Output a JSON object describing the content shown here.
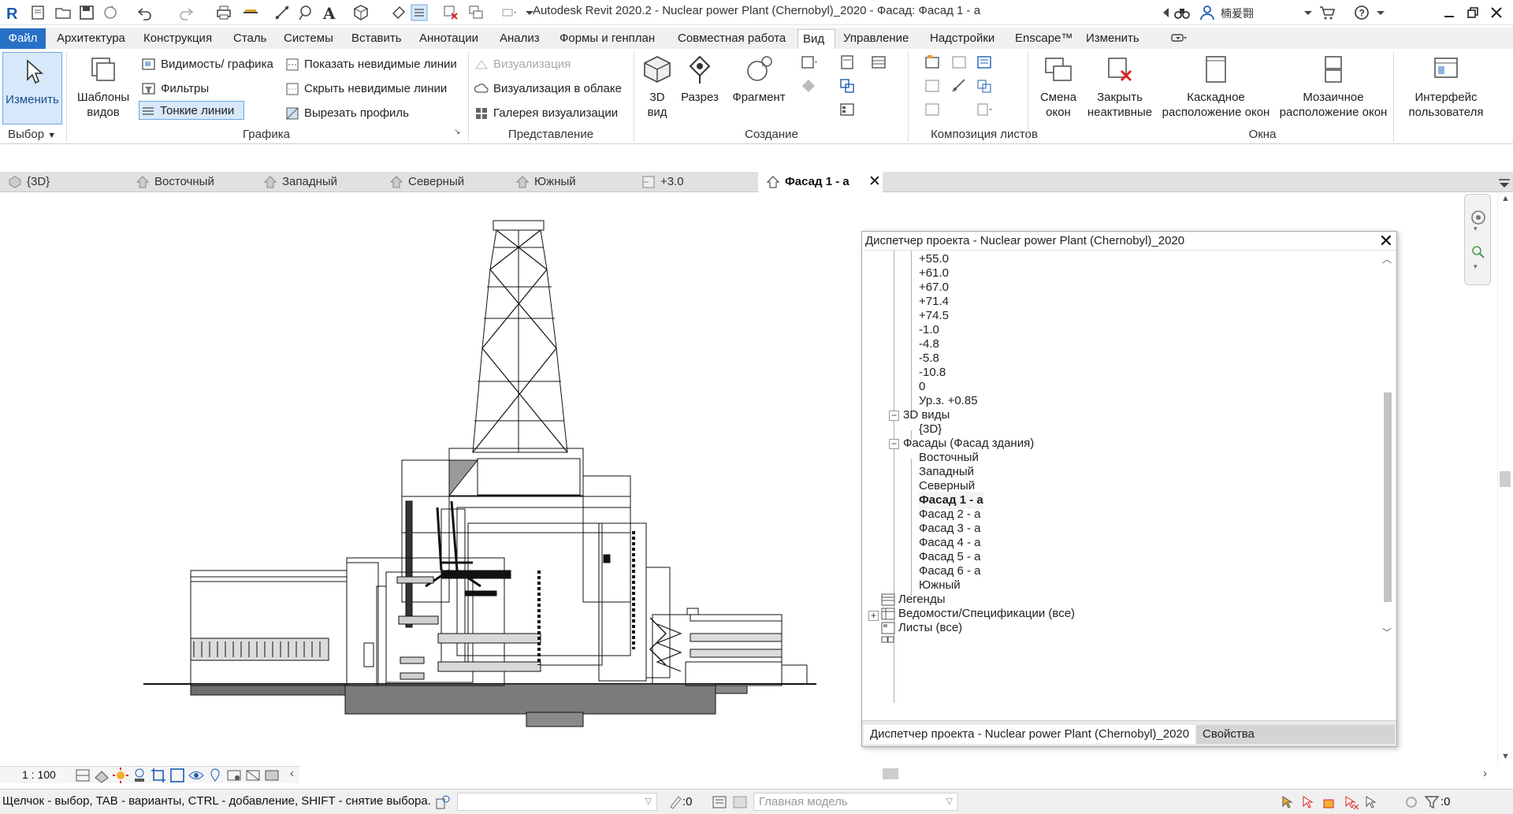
{
  "app_title": "Autodesk Revit 2020.2 - Nuclear power Plant (Chernobyl)_2020 - Фасад: Фасад 1 - а",
  "user_name": "楠爰翾",
  "menu": {
    "file": "Файл",
    "tabs": [
      "Архитектура",
      "Конструкция",
      "Сталь",
      "Системы",
      "Вставить",
      "Аннотации",
      "Анализ",
      "Формы и генплан",
      "Совместная работа",
      "Вид",
      "Управление",
      "Надстройки",
      "Enscape™",
      "Изменить"
    ],
    "active_tab": "Вид"
  },
  "ribbon": {
    "modify_label": "Изменить",
    "templates_label_1": "Шаблоны",
    "templates_label_2": "видов",
    "visibility_graphics": "Видимость/ графика",
    "filters": "Фильтры",
    "thin_lines": "Тонкие линии",
    "show_hidden_lines": "Показать невидимые линии",
    "hide_hidden_lines": "Скрыть невидимые линии",
    "cut_profile": "Вырезать профиль",
    "render": "Визуализация",
    "render_cloud": "Визуализация  в облаке",
    "render_gallery": "Галерея  визуализации",
    "view_3d_1": "3D",
    "view_3d_2": "вид",
    "section": "Разрез",
    "callout": "Фрагмент",
    "switch_windows_1": "Смена",
    "switch_windows_2": "окон",
    "close_inactive_1": "Закрыть",
    "close_inactive_2": "неактивные",
    "cascade_1": "Каскадное",
    "cascade_2": "расположение окон",
    "tile_1": "Мозаичное",
    "tile_2": "расположение окон",
    "ui_1": "Интерфейс",
    "ui_2": "пользователя",
    "panels": {
      "select": "Выбор",
      "graphics": "Графика",
      "presentation": "Представление",
      "create": "Создание",
      "sheet_composition": "Композиция листов",
      "windows": "Окна"
    }
  },
  "doc_tabs": [
    {
      "label": "{3D}"
    },
    {
      "label": "Восточный"
    },
    {
      "label": "Западный"
    },
    {
      "label": "Северный"
    },
    {
      "label": "Южный"
    },
    {
      "label": "+3.0"
    },
    {
      "label": "Фасад 1 - а"
    }
  ],
  "browser": {
    "title": "Диспетчер проекта - Nuclear power Plant (Chernobyl)_2020",
    "levels": [
      "+55.0",
      "+61.0",
      "+67.0",
      "+71.4",
      "+74.5",
      "-1.0",
      "-4.8",
      "-5.8",
      "-10.8",
      "0",
      "Ур.з. +0.85"
    ],
    "views_3d_group": "3D виды",
    "views_3d": [
      "{3D}"
    ],
    "elevations_group": "Фасады (Фасад здания)",
    "elevations": [
      "Восточный",
      "Западный",
      "Северный",
      "Фасад 1 - а",
      "Фасад 2 - а",
      "Фасад 3 - а",
      "Фасад 4 - а",
      "Фасад 5 - а",
      "Фасад 6 - а",
      "Южный"
    ],
    "selected_elevation": "Фасад 1 - а",
    "legends": "Легенды",
    "schedules": "Ведомости/Спецификации (все)",
    "sheets": "Листы (все)",
    "footer_tab_1": "Диспетчер проекта - Nuclear power Plant (Chernobyl)_2020",
    "footer_tab_2": "Свойства"
  },
  "view_control": {
    "scale": "1 : 100"
  },
  "status": {
    "hint": "Щелчок - выбор, TAB - варианты, CTRL - добавление, SHIFT - снятие выбора.",
    "worksets_count": ":0",
    "design_option": "Главная модель",
    "filter_count": ":0"
  },
  "colors": {
    "accent": "#2870c6",
    "menu_bg": "#f0f0f0",
    "tab_bg": "#e1e1e1"
  }
}
